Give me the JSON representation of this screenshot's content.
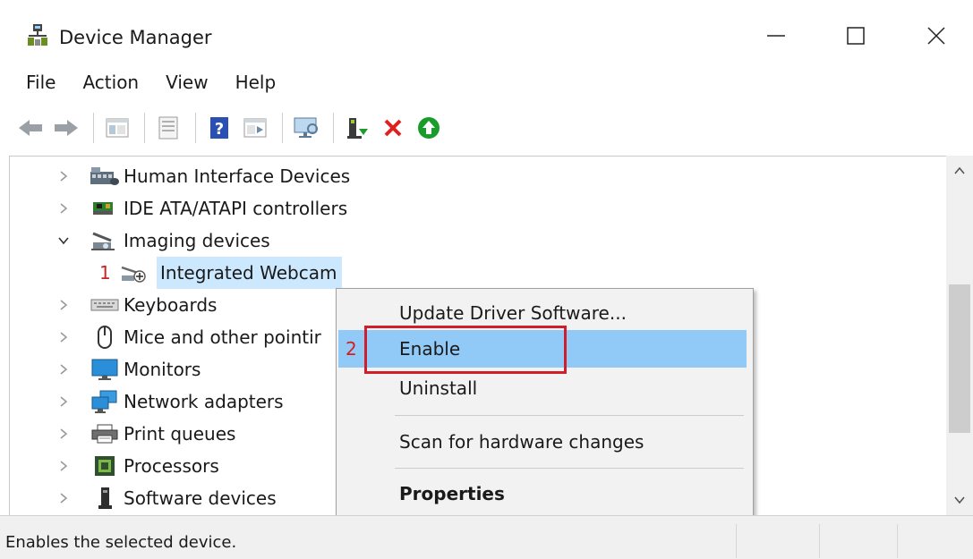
{
  "window": {
    "title": "Device Manager",
    "controls": {
      "minimize": "—",
      "maximize": "☐",
      "close": "✕"
    }
  },
  "menu": [
    "File",
    "Action",
    "View",
    "Help"
  ],
  "toolbar": {
    "buttons": [
      "back-arrow-icon",
      "forward-arrow-icon",
      "show-hide-console-tree-icon",
      "properties-sheet-icon",
      "help-icon",
      "action-pane-icon",
      "monitor-scan-icon",
      "update-driver-icon",
      "uninstall-x-icon",
      "enable-device-icon"
    ],
    "colors": {
      "uninstall": "#e02020",
      "enable": "#1a9c2a",
      "help": "#2a4fb5"
    }
  },
  "tree": {
    "items": [
      {
        "label": "Human Interface Devices",
        "chevron": "›",
        "icon": "hid-icon"
      },
      {
        "label": "IDE ATA/ATAPI controllers",
        "chevron": "›",
        "icon": "ide-controller-icon"
      },
      {
        "label": "Imaging devices",
        "chevron": "⌄",
        "icon": "imaging-device-icon"
      },
      {
        "label": "Integrated Webcam",
        "icon": "webcam-icon",
        "step": "1",
        "selected": true
      },
      {
        "label": "Keyboards",
        "chevron": "›",
        "icon": "keyboard-icon"
      },
      {
        "label": "Mice and other pointir",
        "chevron": "›",
        "icon": "mouse-icon"
      },
      {
        "label": "Monitors",
        "chevron": "›",
        "icon": "monitor-icon"
      },
      {
        "label": "Network adapters",
        "chevron": "›",
        "icon": "network-adapter-icon"
      },
      {
        "label": "Print queues",
        "chevron": "›",
        "icon": "printer-icon"
      },
      {
        "label": "Processors",
        "chevron": "›",
        "icon": "processor-icon"
      },
      {
        "label": "Software devices",
        "chevron": "›",
        "icon": "software-device-icon"
      }
    ]
  },
  "context_menu": {
    "items": [
      {
        "label": "Update Driver Software..."
      },
      {
        "label": "Enable",
        "highlighted": true,
        "step": "2"
      },
      {
        "label": "Uninstall"
      },
      {
        "label": "Scan for hardware changes"
      },
      {
        "label": "Properties",
        "bold": true
      }
    ],
    "highlight_color": "#91c9f7",
    "annotation_color": "#cf1f2a"
  },
  "scrollbar": {
    "up": "^",
    "down": "⌄"
  },
  "status": {
    "text": "Enables the selected device."
  }
}
